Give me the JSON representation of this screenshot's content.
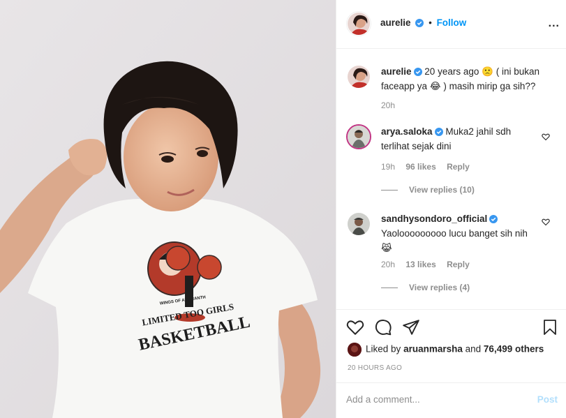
{
  "header": {
    "username": "aurelie",
    "follow_label": "Follow",
    "separator": "•",
    "more_label": "..."
  },
  "caption": {
    "username": "aurelie",
    "text_1": "20 years ago",
    "emoji_1": "🙁",
    "text_2": "( ini bukan faceapp ya",
    "emoji_2": "😂",
    "text_3": ") masih mirip ga sih??",
    "time": "20h"
  },
  "comments": [
    {
      "username": "arya.saloka",
      "text": "Muka2 jahil sdh terlihat sejak dini",
      "time": "19h",
      "likes": "96 likes",
      "reply_label": "Reply",
      "view_replies": "View replies (10)"
    },
    {
      "username": "sandhysondoro_official",
      "text": "Yaolooooooooo lucu banget sih nih",
      "emoji": "😹",
      "time": "20h",
      "likes": "13 likes",
      "reply_label": "Reply",
      "view_replies": "View replies (4)"
    }
  ],
  "liked": {
    "prefix": "Liked by",
    "user": "aruanmarsha",
    "and": "and",
    "count": "76,499 others"
  },
  "timestamp": "20 HOURS AGO",
  "composer": {
    "placeholder": "Add a comment...",
    "post_label": "Post"
  },
  "photo": {
    "shirt_text_top": "LIMITED TOO GIRLS",
    "shirt_text_bottom": "BASKETBALL",
    "shirt_text_small": "WINGS OF AMARANTH"
  },
  "colors": {
    "accent": "#0095f6",
    "post_disabled": "#b2dffc",
    "verified": "#3897f0",
    "meta_gray": "#8e8e8e"
  }
}
